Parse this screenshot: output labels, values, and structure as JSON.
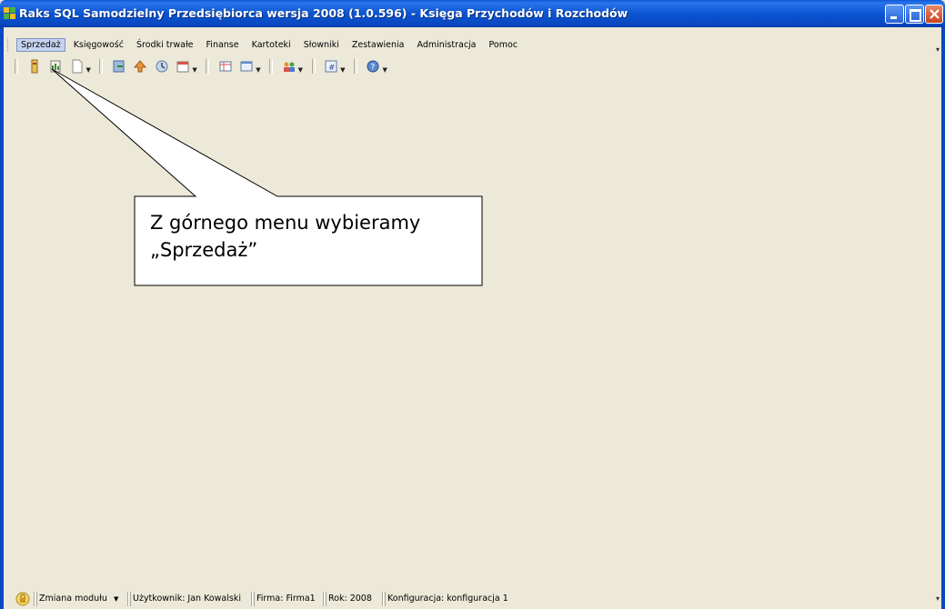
{
  "window": {
    "title": "Raks SQL Samodzielny Przedsiębiorca wersja 2008 (1.0.596) - Księga Przychodów i Rozchodów",
    "icon": "app-logo-icon",
    "buttons": [
      "minimize",
      "maximize",
      "close"
    ]
  },
  "menu": {
    "items": [
      {
        "label": "Sprzedaż",
        "active": true
      },
      {
        "label": "Księgowość"
      },
      {
        "label": "Środki trwałe"
      },
      {
        "label": "Finanse"
      },
      {
        "label": "Kartoteki"
      },
      {
        "label": "Słowniki"
      },
      {
        "label": "Zestawienia"
      },
      {
        "label": "Administracja"
      },
      {
        "label": "Pomoc"
      }
    ]
  },
  "toolbar": {
    "icons": [
      "invoice-icon",
      "receipts-icon",
      "document-icon",
      "import-icon",
      "export-icon",
      "globe-icon",
      "calendar-icon",
      "table-icon",
      "window-icon",
      "users-icon",
      "number-icon",
      "help-icon"
    ]
  },
  "callout": {
    "line1": "Z górnego menu wybieramy",
    "line2": "„Sprzedaż”"
  },
  "status": {
    "module_button": "Zmiana modułu",
    "user": "Użytkownik: Jan Kowalski",
    "company": "Firma: Firma1",
    "year": "Rok: 2008",
    "config": "Konfiguracja: konfiguracja 1"
  },
  "colors": {
    "titlebar": "#0a55d3",
    "background": "#ece9d8",
    "menu_active": "#c6d3ef"
  }
}
